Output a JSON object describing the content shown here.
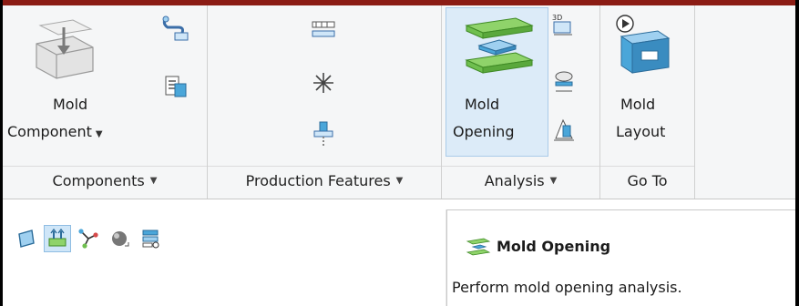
{
  "ribbon": {
    "groups": [
      {
        "label": "Components",
        "has_dropdown": true
      },
      {
        "label": "Production Features",
        "has_dropdown": true
      },
      {
        "label": "Analysis",
        "has_dropdown": true
      },
      {
        "label": "Go To",
        "has_dropdown": false
      }
    ],
    "mold_component": {
      "line1": "Mold",
      "line2": "Component",
      "has_dropdown": true
    },
    "mold_opening": {
      "line1": "Mold",
      "line2": "Opening"
    },
    "mold_layout": {
      "line1": "Mold",
      "line2": "Layout"
    }
  },
  "tooltip": {
    "title": "Mold Opening",
    "description": "Perform mold opening analysis."
  },
  "lower_toolbar": {
    "icons": [
      "face-icon",
      "mold-base-icon",
      "branch-icon",
      "shaded-sphere-icon",
      "stack-view-icon"
    ],
    "active_index": 1
  },
  "colors": {
    "title_bar": "#8b1c14",
    "highlight_bg": "#dcebf8",
    "mold_green": "#6fbf4f",
    "mold_blue": "#4aa6d9"
  }
}
